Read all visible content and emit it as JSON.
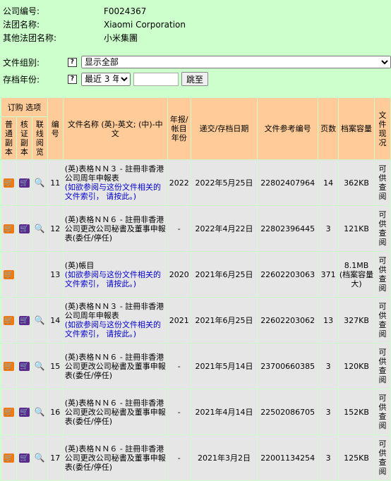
{
  "company": {
    "number_label": "公司编号:",
    "number_value": "F0024367",
    "name_label": "法团名称:",
    "name_value": "Xiaomi Corporation",
    "other_label": "其他法团名称:",
    "other_value": "小米集團"
  },
  "filters": {
    "group_label": "文件组别:",
    "group_value": "显示全部",
    "year_label": "存档年份:",
    "year_value": "最近 3 年",
    "go_label": "跳至",
    "help_icon": "question-icon"
  },
  "table": {
    "header_order": "订购 选项",
    "h_copy": "普通副本",
    "h_cert": "核证副本",
    "h_online": "联线阅览",
    "h_no": "编号",
    "h_name": "文件名称 (英)-英文; (中)-中文",
    "h_year": "年报/帐目年份",
    "h_date": "递交/存档日期",
    "h_ref": "文件参考编号",
    "h_pages": "页数",
    "h_size": "档案容量",
    "h_status": "文件现况",
    "rows": [
      {
        "no": "11",
        "name": "(英)表格ＮＮ３ - 註冊非香港公司周年申報表",
        "note": "(如欲参阅与这份文件相关的文件索引， 请按此。)",
        "year": "2022",
        "date": "2022年5月25日",
        "ref": "22802407964",
        "pages": "14",
        "size": "362KB",
        "status": "可供查阅",
        "cert": true,
        "online": true
      },
      {
        "no": "12",
        "name": "(英)表格ＮＮ６ - 註冊非香港公司更改公司秘書及董事申報表(委任/停任)",
        "note": "",
        "year": "-",
        "date": "2022年4月22日",
        "ref": "22802396445",
        "pages": "3",
        "size": "121KB",
        "status": "可供查阅",
        "cert": true,
        "online": true
      },
      {
        "no": "13",
        "name": "(英)帳目",
        "note": "(如欲参阅与这份文件相关的文件索引， 请按此。)",
        "year": "2020",
        "date": "2021年6月25日",
        "ref": "22602203063",
        "pages": "371",
        "size": "8.1MB (档案容量大)",
        "status": "可供查阅",
        "cert": false,
        "online": false
      },
      {
        "no": "14",
        "name": "(英)表格ＮＮ３ - 註冊非香港公司周年申報表",
        "note": "(如欲参阅与这份文件相关的文件索引， 请按此。)",
        "year": "2021",
        "date": "2021年6月25日",
        "ref": "22602203062",
        "pages": "13",
        "size": "327KB",
        "status": "可供查阅",
        "cert": true,
        "online": true
      },
      {
        "no": "15",
        "name": "(英)表格ＮＮ６ - 註冊非香港公司更改公司秘書及董事申報表(委任/停任)",
        "note": "",
        "year": "-",
        "date": "2021年5月14日",
        "ref": "23700660385",
        "pages": "3",
        "size": "120KB",
        "status": "可供查阅",
        "cert": true,
        "online": true
      },
      {
        "no": "16",
        "name": "(英)表格ＮＮ６ - 註冊非香港公司更改公司秘書及董事申報表(委任/停任)",
        "note": "",
        "year": "-",
        "date": "2021年4月14日",
        "ref": "22502086705",
        "pages": "3",
        "size": "152KB",
        "status": "可供查阅",
        "cert": true,
        "online": true
      },
      {
        "no": "17",
        "name": "(英)表格ＮＮ６ - 註冊非香港公司更改公司秘書及董事申報表(委任/停任)",
        "note": "",
        "year": "-",
        "date": "2021年3月2日",
        "ref": "22001134254",
        "pages": "3",
        "size": "125KB",
        "status": "可供查阅",
        "cert": true,
        "online": true
      }
    ]
  }
}
